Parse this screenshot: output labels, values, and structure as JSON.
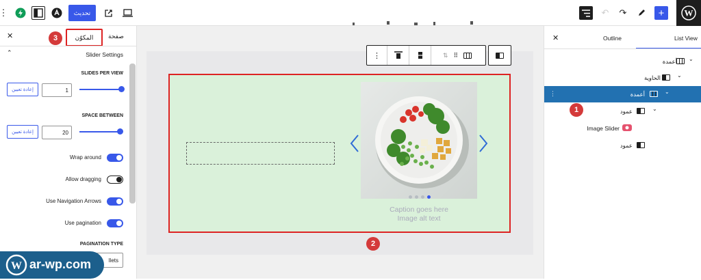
{
  "topbar": {
    "update_label": "تحديث",
    "icons": [
      "more-vertical-icon",
      "performance-icon",
      "sidebar-toggle-icon",
      "astra-logo-icon",
      "external-link-icon",
      "desktop-preview-icon",
      "list-view-icon",
      "undo-icon",
      "redo-icon",
      "edit-pen-icon",
      "add-block-icon",
      "wordpress-logo-icon"
    ]
  },
  "left_sidebar": {
    "tab_page": "صفحة",
    "tab_block": "المكوّن",
    "section_title": "Slider Settings",
    "slides_per_view": {
      "label": "SLIDES PER VIEW",
      "reset": "إعادة تعيين",
      "value": "1",
      "fill": 0.95
    },
    "space_between": {
      "label": "SPACE BETWEEN",
      "reset": "إعادة تعيين",
      "value": "20",
      "fill": 0.92
    },
    "toggles": [
      {
        "label": "Wrap around",
        "on": true
      },
      {
        "label": "Allow dragging",
        "on": true
      },
      {
        "label": "Use Navigation Arrows",
        "on": true
      },
      {
        "label": "Use pagination",
        "on": true
      }
    ],
    "pagination_type": {
      "label": "PAGINATION TYPE",
      "value": "llets"
    }
  },
  "canvas": {
    "caption_line1": "Caption goes here",
    "caption_line2": "Image alt text",
    "dots": 4,
    "active_dot": 3
  },
  "right_panel": {
    "tab_outline": "Outline",
    "tab_list": "List View",
    "tree": [
      {
        "label": "أعمدة",
        "icon": "columns-icon",
        "level": 0,
        "selected": false
      },
      {
        "label": "الحاوية",
        "icon": "group-icon",
        "level": 1,
        "selected": false
      },
      {
        "label": "أعمدة",
        "icon": "columns-icon",
        "level": 2,
        "selected": true
      },
      {
        "label": "عمود",
        "icon": "column-icon",
        "level": 3,
        "selected": false
      },
      {
        "label": "Image Slider",
        "icon": "image-slider-icon",
        "level": 4,
        "selected": false
      },
      {
        "label": "عمود",
        "icon": "column-icon",
        "level": 3,
        "selected": false
      }
    ]
  },
  "callouts": [
    "1",
    "2",
    "3"
  ],
  "watermark": {
    "text": "ar-wp.com"
  },
  "colors": {
    "accent": "#3858e9",
    "callout": "#d43a3a",
    "highlight": "#d22",
    "selected_row": "#2271b1"
  }
}
